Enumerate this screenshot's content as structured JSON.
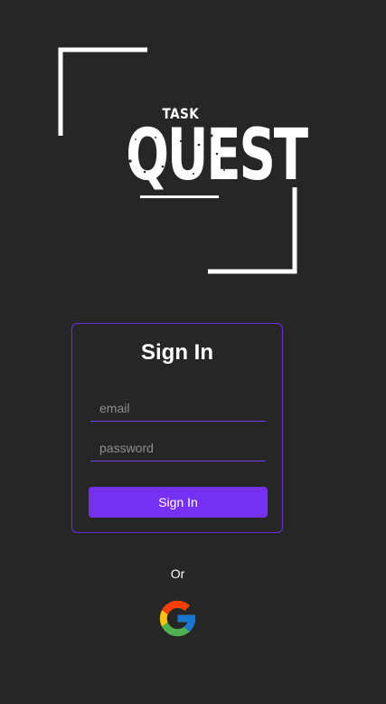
{
  "logo": {
    "small_text": "TASK",
    "big_text": "QUEST"
  },
  "signin": {
    "title": "Sign In",
    "email_placeholder": "email",
    "email_value": "",
    "password_placeholder": "password",
    "password_value": "",
    "button_label": "Sign In"
  },
  "alt_login": {
    "or_label": "Or",
    "google_icon": "google-logo-icon"
  },
  "colors": {
    "background": "#262626",
    "accent": "#7630f2",
    "card_border": "#6a2fd8",
    "text": "#ffffff",
    "placeholder": "#8e8e8e"
  }
}
